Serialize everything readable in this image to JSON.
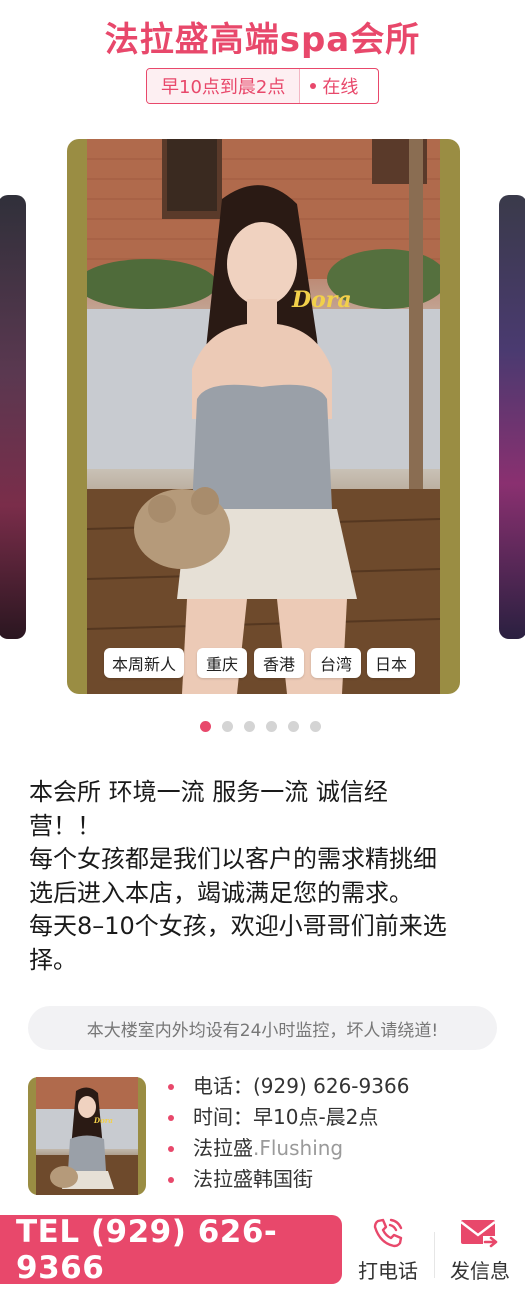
{
  "header": {
    "title": "法拉盛高端spa会所",
    "hours": "早10点到晨2点",
    "status": "在线"
  },
  "carousel": {
    "slide_count": 6,
    "active_index": 0,
    "watermark": "Dora",
    "tags": [
      "本周新人",
      "重庆",
      "香港",
      "台湾",
      "日本"
    ]
  },
  "description": [
    "本会所 环境一流 服务一流 诚信经",
    "营！！",
    "每个女孩都是我们以客户的需求精挑细",
    "选后进入本店，竭诚满足您的需求。",
    "每天8–10个女孩，欢迎小哥哥们前来选",
    "择。"
  ],
  "warning": "本大楼室内外均设有24小时监控，坏人请绕道!",
  "contact": {
    "phone": "电话：(929) 626-9366",
    "time": "时间：早10点-晨2点",
    "location_main": "法拉盛",
    "location_suffix": ".Flushing",
    "area": "法拉盛韩国街"
  },
  "bottom": {
    "tel_label": "TEL (929) 626-9366",
    "call_label": "打电话",
    "message_label": "发信息"
  },
  "colors": {
    "accent": "#e8486b",
    "card_frame": "#9a8d43"
  }
}
